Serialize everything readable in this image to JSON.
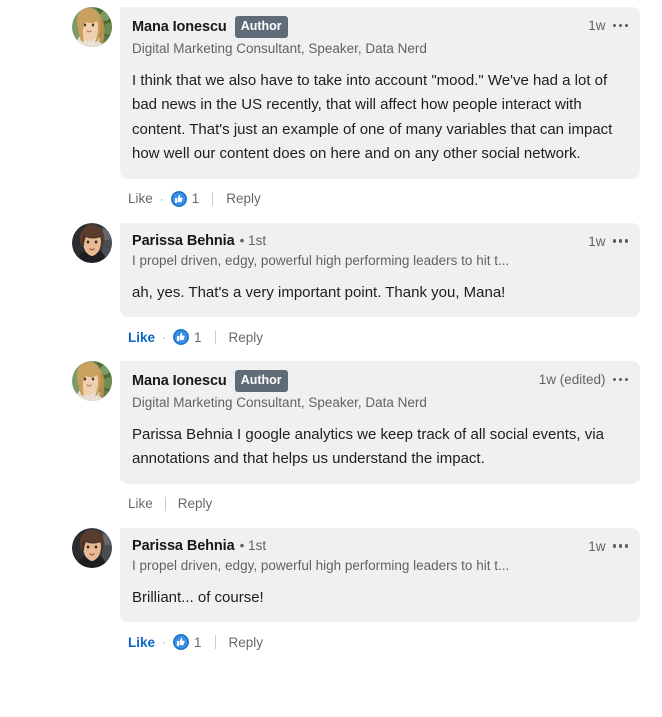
{
  "thread": {
    "comments": [
      {
        "author_name": "Mana Ionescu",
        "badge": "Author",
        "degree": "",
        "headline": "Digital Marketing Consultant, Speaker, Data Nerd",
        "timestamp": "1w",
        "body": "I think that we also have to take into account \"mood.\" We've had a lot of bad news in the US recently, that will affect how people interact with content. That's just an example of one of many variables that can impact how well our content does on here and on any other social network.",
        "like_label": "Like",
        "reply_label": "Reply",
        "reaction_count": "1",
        "liked": false,
        "avatar": "avatar-mana-ionescu"
      },
      {
        "author_name": "Parissa Behnia",
        "badge": "",
        "degree": "• 1st",
        "headline": "I propel driven, edgy, powerful high performing leaders to hit t...",
        "timestamp": "1w",
        "body": "ah, yes. That's a very important point. Thank you, Mana!",
        "like_label": "Like",
        "reply_label": "Reply",
        "reaction_count": "1",
        "liked": true,
        "avatar": "avatar-parissa-behnia"
      },
      {
        "author_name": "Mana Ionescu",
        "badge": "Author",
        "degree": "",
        "headline": "Digital Marketing Consultant, Speaker, Data Nerd",
        "timestamp": "1w (edited)",
        "body": "Parissa Behnia I google analytics we keep track of all social events, via annotations and that helps us understand the impact.",
        "like_label": "Like",
        "reply_label": "Reply",
        "reaction_count": "",
        "liked": false,
        "avatar": "avatar-mana-ionescu"
      },
      {
        "author_name": "Parissa Behnia",
        "badge": "",
        "degree": "• 1st",
        "headline": "I propel driven, edgy, powerful high performing leaders to hit t...",
        "timestamp": "1w",
        "body": "Brilliant... of course!",
        "like_label": "Like",
        "reply_label": "Reply",
        "reaction_count": "1",
        "liked": true,
        "avatar": "avatar-parissa-behnia"
      }
    ]
  },
  "colors": {
    "bubble_bg": "#eef0f1",
    "link_blue": "#0a66c2",
    "badge_bg": "#5f6b77",
    "text_primary": "#000000e0",
    "text_secondary": "#00000099"
  }
}
